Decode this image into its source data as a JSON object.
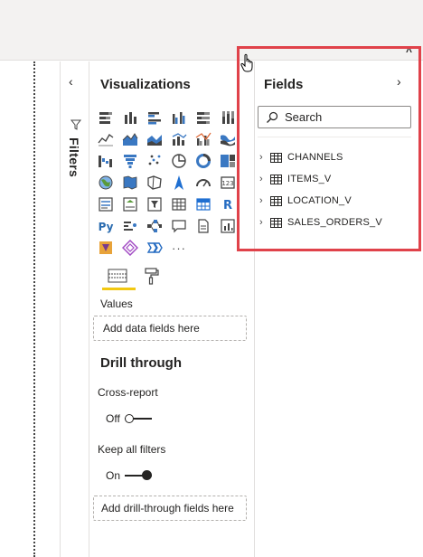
{
  "ribbon": {
    "collapse_icon": "chevron-up-icon"
  },
  "filters": {
    "label": "Filters",
    "collapse_icon": "chevron-left-icon",
    "funnel_icon": "funnel-icon"
  },
  "visualizations": {
    "title": "Visualizations",
    "more_label": "···",
    "icons": [
      "stacked-bar-icon",
      "stacked-column-icon",
      "clustered-bar-icon",
      "clustered-column-icon",
      "100-bar-icon",
      "100-column-icon",
      "line-chart-icon",
      "area-chart-icon",
      "stacked-area-icon",
      "line-column-icon",
      "line-clustered-column-icon",
      "ribbon-chart-icon",
      "waterfall-icon",
      "funnel-chart-icon",
      "scatter-icon",
      "pie-icon",
      "donut-icon",
      "treemap-icon",
      "map-icon",
      "filled-map-icon",
      "shape-map-icon",
      "azure-map-icon",
      "gauge-icon",
      "card-icon",
      "multirow-card-icon",
      "kpi-icon",
      "slicer-icon",
      "table-visual-icon",
      "matrix-icon",
      "r-visual-icon",
      "python-visual-icon",
      "key-influencers-icon",
      "decomposition-tree-icon",
      "qa-icon",
      "paginated-report-icon",
      "smart-narrative-icon",
      "power-apps-icon",
      "power-automate-icon",
      "metrics-icon"
    ],
    "tabs": {
      "fields_icon": "fields-tab-icon",
      "format_icon": "paint-roller-icon"
    },
    "values_label": "Values",
    "values_placeholder": "Add data fields here",
    "drill_title": "Drill through",
    "cross_report_label": "Cross-report",
    "cross_report_state": "Off",
    "keep_filters_label": "Keep all filters",
    "keep_filters_state": "On",
    "drill_placeholder": "Add drill-through fields here"
  },
  "fields": {
    "title": "Fields",
    "expand_icon": "chevron-right-icon",
    "search_placeholder": "Search",
    "tables": [
      "CHANNELS",
      "ITEMS_V",
      "LOCATION_V",
      "SALES_ORDERS_V"
    ]
  },
  "colors": {
    "highlight": "#e0424a",
    "accent_underline": "#f2c811",
    "pbi_yellow": "#f2c811"
  }
}
